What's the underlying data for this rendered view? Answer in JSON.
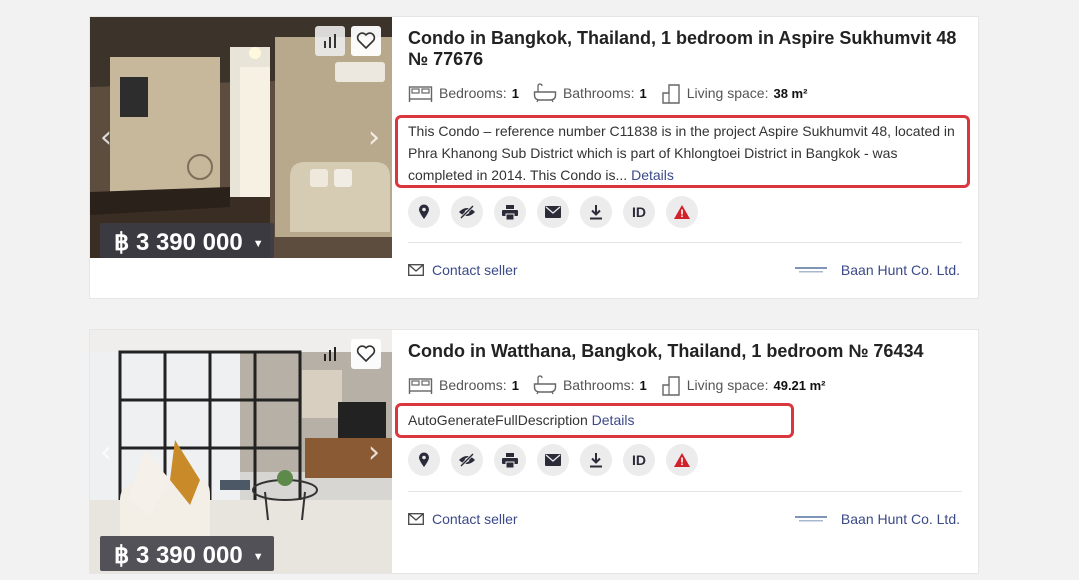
{
  "listings": [
    {
      "title": "Condo in Bangkok, Thailand, 1 bedroom in Aspire Sukhumvit 48 № 77676",
      "price": "฿ 3 390 000",
      "bedrooms_label": "Bedrooms:",
      "bedrooms": "1",
      "bathrooms_label": "Bathrooms:",
      "bathrooms": "1",
      "living_label": "Living space:",
      "living": "38 m²",
      "description": "This Condo – reference number C11838 is in the project Aspire Sukhumvit 48, located in Phra Khanong Sub District which is part of Khlongtoei District in Bangkok - was completed in 2014. This Condo is...",
      "details_link": "Details",
      "contact": "Contact seller",
      "agency": "Baan Hunt Co. Ltd."
    },
    {
      "title": "Condo in Watthana, Bangkok, Thailand, 1 bedroom № 76434",
      "price": "฿ 3 390 000",
      "bedrooms_label": "Bedrooms:",
      "bedrooms": "1",
      "bathrooms_label": "Bathrooms:",
      "bathrooms": "1",
      "living_label": "Living space:",
      "living": "49.21 m²",
      "description": "AutoGenerateFullDescription",
      "details_link": "Details",
      "contact": "Contact seller",
      "agency": "Baan Hunt Co. Ltd."
    }
  ],
  "actions": {
    "id_label": "ID"
  },
  "colors": {
    "highlight": "#d9363e",
    "link": "#3b4a88",
    "report": "#d0202a"
  },
  "icons": [
    "stats-icon",
    "heart-icon",
    "map-pin-icon",
    "hide-icon",
    "print-icon",
    "mail-icon",
    "download-icon",
    "warning-icon",
    "bed-icon",
    "bath-icon",
    "area-icon"
  ]
}
